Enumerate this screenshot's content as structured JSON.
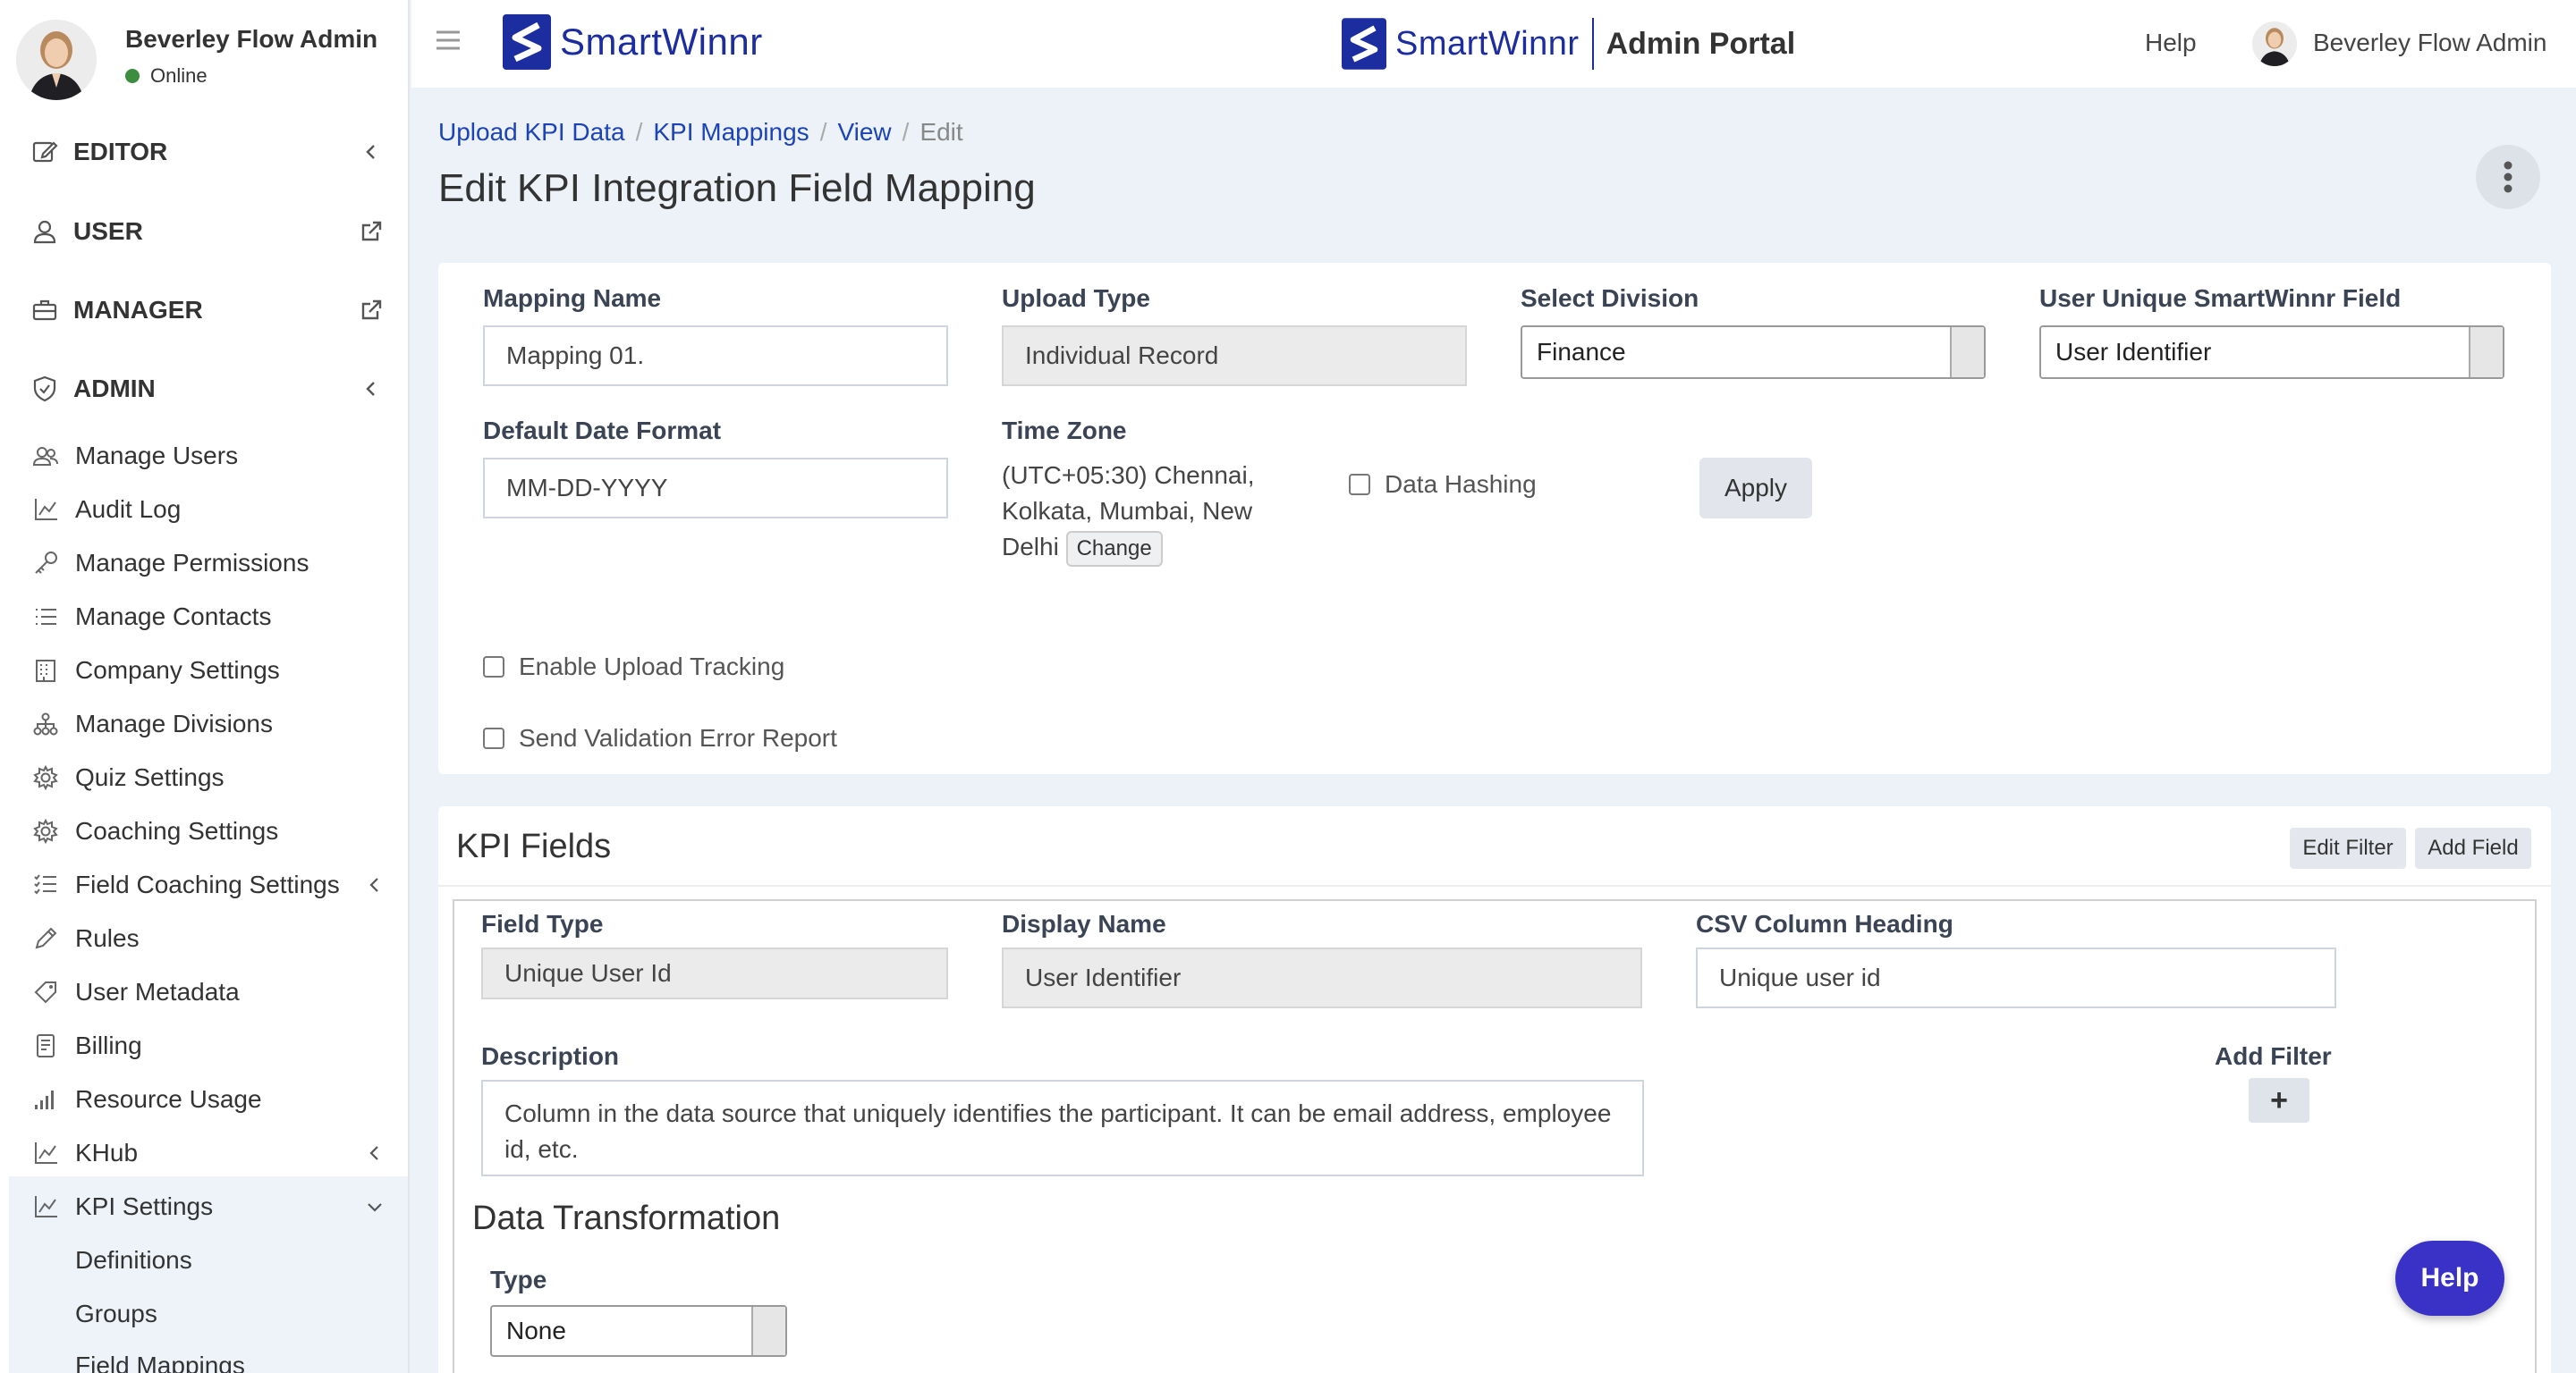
{
  "user": {
    "name": "Beverley Flow Admin",
    "status": "Online"
  },
  "sidebar": {
    "sections": [
      {
        "label": "EDITOR"
      },
      {
        "label": "USER"
      },
      {
        "label": "MANAGER"
      },
      {
        "label": "ADMIN"
      }
    ],
    "items": [
      {
        "label": "Manage Users"
      },
      {
        "label": "Audit Log"
      },
      {
        "label": "Manage Permissions"
      },
      {
        "label": "Manage Contacts"
      },
      {
        "label": "Company Settings"
      },
      {
        "label": "Manage Divisions"
      },
      {
        "label": "Quiz Settings"
      },
      {
        "label": "Coaching Settings"
      },
      {
        "label": "Field Coaching Settings"
      },
      {
        "label": "Rules"
      },
      {
        "label": "User Metadata"
      },
      {
        "label": "Billing"
      },
      {
        "label": "Resource Usage"
      },
      {
        "label": "KHub"
      },
      {
        "label": "KPI Settings"
      }
    ],
    "kpi_sub": [
      {
        "label": "Definitions"
      },
      {
        "label": "Groups"
      },
      {
        "label": "Field Mappings"
      }
    ]
  },
  "header": {
    "brand": "SmartWinnr",
    "portal": "Admin Portal",
    "help": "Help",
    "user": "Beverley Flow Admin"
  },
  "breadcrumb": {
    "items": [
      "Upload KPI Data",
      "KPI Mappings",
      "View"
    ],
    "current": "Edit"
  },
  "page_title": "Edit KPI Integration Field Mapping",
  "form": {
    "mapping_name": {
      "label": "Mapping Name",
      "value": "Mapping 01."
    },
    "upload_type": {
      "label": "Upload Type",
      "value": "Individual Record"
    },
    "division": {
      "label": "Select Division",
      "value": "Finance"
    },
    "unique_field": {
      "label": "User Unique SmartWinnr Field",
      "value": "User Identifier"
    },
    "date_format": {
      "label": "Default Date Format",
      "value": "MM-DD-YYYY"
    },
    "time_zone": {
      "label": "Time Zone",
      "value": "(UTC+05:30) Chennai, Kolkata, Mumbai, New Delhi",
      "change": "Change"
    },
    "data_hashing": "Data Hashing",
    "apply": "Apply",
    "upload_tracking": "Enable Upload Tracking",
    "validation_report": "Send Validation Error Report"
  },
  "kpi_fields": {
    "title": "KPI Fields",
    "edit_filter": "Edit Filter",
    "add_field": "Add Field",
    "field_type": {
      "label": "Field Type",
      "value": "Unique User Id"
    },
    "display_name": {
      "label": "Display Name",
      "value": "User Identifier"
    },
    "csv_heading": {
      "label": "CSV Column Heading",
      "value": "Unique user id"
    },
    "description": {
      "label": "Description",
      "value": "Column in the data source that uniquely identifies the participant. It can be email address, employee id, etc."
    },
    "add_filter": "Add Filter",
    "plus": "+",
    "data_transformation": "Data Transformation",
    "type": {
      "label": "Type",
      "value": "None"
    }
  },
  "help_fab": "Help",
  "colors": {
    "brand": "#1c2da0",
    "link": "#1c44b8",
    "fab": "#3a32c7",
    "online": "#3c8d40"
  }
}
